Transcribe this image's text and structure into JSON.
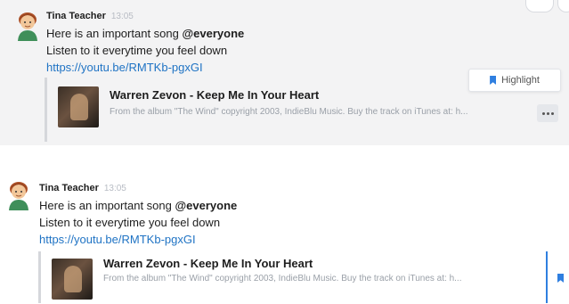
{
  "messages": [
    {
      "author": "Tina Teacher",
      "time": "13:05",
      "line1_prefix": "Here is an important song ",
      "line1_mention": "@everyone",
      "line2": "Listen to it everytime you feel down",
      "link": "https://youtu.be/RMTKb-pgxGI",
      "embed": {
        "title": "Warren Zevon - Keep Me In Your Heart",
        "description": "From the album \"The Wind\" copyright 2003, IndieBlu Music. Buy the track on iTunes at: h..."
      }
    },
    {
      "author": "Tina Teacher",
      "time": "13:05",
      "line1_prefix": "Here is an important song ",
      "line1_mention": "@everyone",
      "line2": "Listen to it everytime you feel down",
      "link": "https://youtu.be/RMTKb-pgxGI",
      "embed": {
        "title": "Warren Zevon - Keep Me In Your Heart",
        "description": "From the album \"The Wind\" copyright 2003, IndieBlu Music. Buy the track on iTunes at: h..."
      }
    }
  ],
  "hover_actions": {
    "highlight_label": "Highlight",
    "highlight_icon": "bookmark-icon",
    "more_icon": "more-options-icon"
  },
  "colors": {
    "link": "#1f73c4",
    "accent": "#2f7fe0",
    "hover_background": "#f3f3f4"
  }
}
